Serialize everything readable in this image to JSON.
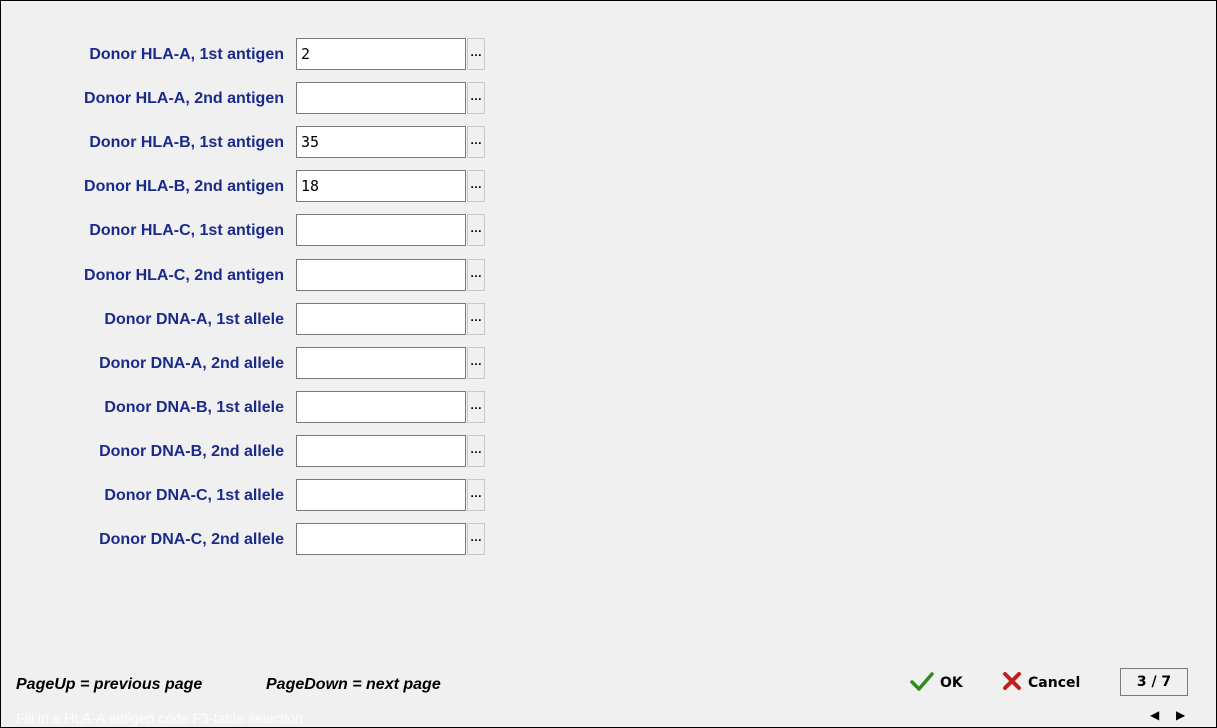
{
  "fields": [
    {
      "label": "Donor HLA-A, 1st antigen",
      "value": "2"
    },
    {
      "label": "Donor HLA-A, 2nd antigen",
      "value": ""
    },
    {
      "label": "Donor HLA-B, 1st antigen",
      "value": "35"
    },
    {
      "label": "Donor HLA-B, 2nd antigen",
      "value": "18"
    },
    {
      "label": "Donor HLA-C, 1st antigen",
      "value": ""
    },
    {
      "label": "Donor HLA-C, 2nd antigen",
      "value": ""
    },
    {
      "label": "Donor DNA-A, 1st allele",
      "value": ""
    },
    {
      "label": "Donor DNA-A, 2nd allele",
      "value": ""
    },
    {
      "label": "Donor DNA-B, 1st allele",
      "value": ""
    },
    {
      "label": "Donor DNA-B, 2nd allele",
      "value": ""
    },
    {
      "label": "Donor DNA-C, 1st allele",
      "value": ""
    },
    {
      "label": "Donor DNA-C, 2nd allele",
      "value": ""
    }
  ],
  "ellipsis_label": "…",
  "hints": {
    "page_up": "PageUp = previous page",
    "page_down": "PageDown = next page"
  },
  "buttons": {
    "ok": "OK",
    "cancel": "Cancel"
  },
  "page_indicator": "3 / 7",
  "status_text": "Fill in a HLA-A antigen code F3-table selection",
  "nav": {
    "prev_icon": "left-triangle-icon",
    "next_icon": "right-triangle-icon"
  },
  "colors": {
    "label": "#1a2a8c",
    "ok_check": "#2e8b1e",
    "cancel_x": "#c0201a"
  }
}
